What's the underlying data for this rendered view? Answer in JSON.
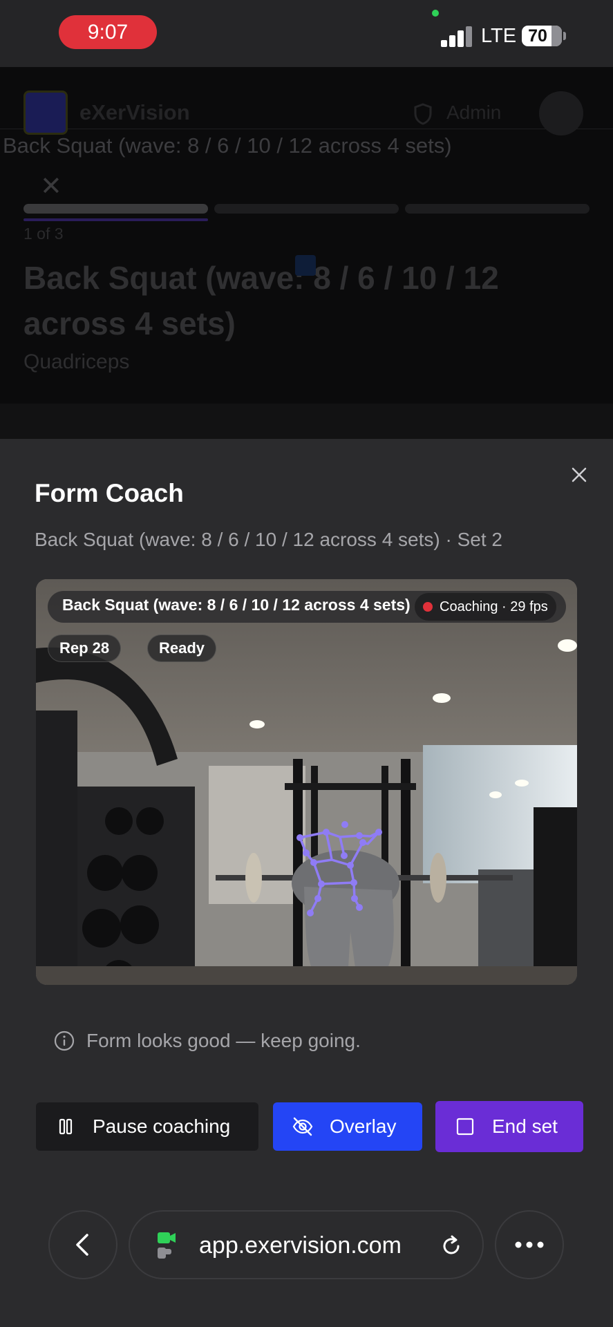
{
  "status_bar": {
    "time": "9:07",
    "network": "LTE",
    "battery": "70"
  },
  "background_page": {
    "brand": "eXerVision",
    "admin_label": "Admin",
    "breadcrumb": "Back Squat (wave: 8 / 6 / 10 / 12 across 4 sets)",
    "step_counter": "1 of 3",
    "exercise_title": "Back Squat (wave: 8 / 6 / 10 / 12 across 4 sets)",
    "muscle_group": "Quadriceps"
  },
  "form_coach": {
    "title": "Form Coach",
    "subtitle": "Back Squat (wave: 8 / 6 / 10 / 12 across 4 sets) · Set 2",
    "video": {
      "overlay_title": "Back Squat (wave: 8 / 6 / 10 / 12 across 4 sets)",
      "coaching_status": "Coaching · 29 fps",
      "rep_counter": "Rep 28",
      "state": "Ready"
    },
    "feedback": "Form looks good — keep going.",
    "buttons": {
      "pause": "Pause coaching",
      "overlay": "Overlay",
      "end_set": "End set"
    }
  },
  "browser": {
    "url": "app.exervision.com"
  },
  "colors": {
    "overlay_button": "#2445f5",
    "end_set_button": "#6a2dd6",
    "skeleton": "#8f7cf5",
    "recording_dot": "#e0313a"
  },
  "icons": {
    "close": "close-icon",
    "info": "info-icon",
    "pause": "pause-icon",
    "overlay": "eye-off-icon",
    "end_set": "square-icon",
    "back": "chevron-left-icon",
    "reload": "reload-icon",
    "more": "more-icon"
  }
}
